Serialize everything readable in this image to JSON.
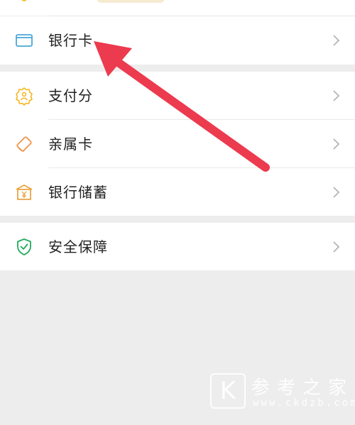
{
  "menu": {
    "group1": [
      {
        "label": "银行卡",
        "icon": "bank-card-icon"
      }
    ],
    "group2": [
      {
        "label": "支付分",
        "icon": "payment-score-icon"
      },
      {
        "label": "亲属卡",
        "icon": "family-card-icon"
      },
      {
        "label": "银行储蓄",
        "icon": "bank-savings-icon"
      }
    ],
    "group3": [
      {
        "label": "安全保障",
        "icon": "shield-icon"
      }
    ]
  },
  "watermark": {
    "logo": "K",
    "title": "参考之家",
    "url": "www.ckdzb.com"
  },
  "colors": {
    "background": "#ededed",
    "card": "#ffffff",
    "bank_card_icon": "#4aa7d8",
    "payment_score_icon": "#f3b61f",
    "family_card_icon": "#f0954a",
    "bank_savings_icon": "#e9a13b",
    "shield_icon": "#22ac5c",
    "arrow": "#ec3a4e",
    "chevron": "#b5b5b5"
  }
}
